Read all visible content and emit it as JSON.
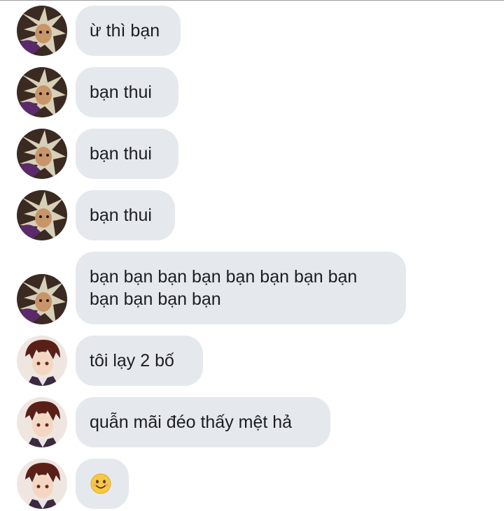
{
  "messages": [
    {
      "sender": "friend-a",
      "text": "ừ thì bạn"
    },
    {
      "sender": "friend-a",
      "text": "bạn thui"
    },
    {
      "sender": "friend-a",
      "text": "bạn thui"
    },
    {
      "sender": "friend-a",
      "text": "bạn thui"
    },
    {
      "sender": "friend-a",
      "lines": [
        "bạn bạn bạn bạn bạn bạn bạn bạn",
        "bạn bạn bạn bạn"
      ]
    },
    {
      "sender": "friend-b",
      "text": "tôi lạy 2 bố"
    },
    {
      "sender": "friend-b",
      "text": "quẫn mãi đéo thấy mệt hả"
    },
    {
      "sender": "friend-b",
      "emoji": "smiling-face-emoji"
    }
  ],
  "colors": {
    "bubble_bg": "#e5e9ee",
    "text": "#1c1e21",
    "emoji_face": "#f7c843"
  },
  "icons": {
    "avatar_a": "dark-hair-anime-avatar-icon",
    "avatar_b": "red-hair-anime-avatar-icon"
  }
}
